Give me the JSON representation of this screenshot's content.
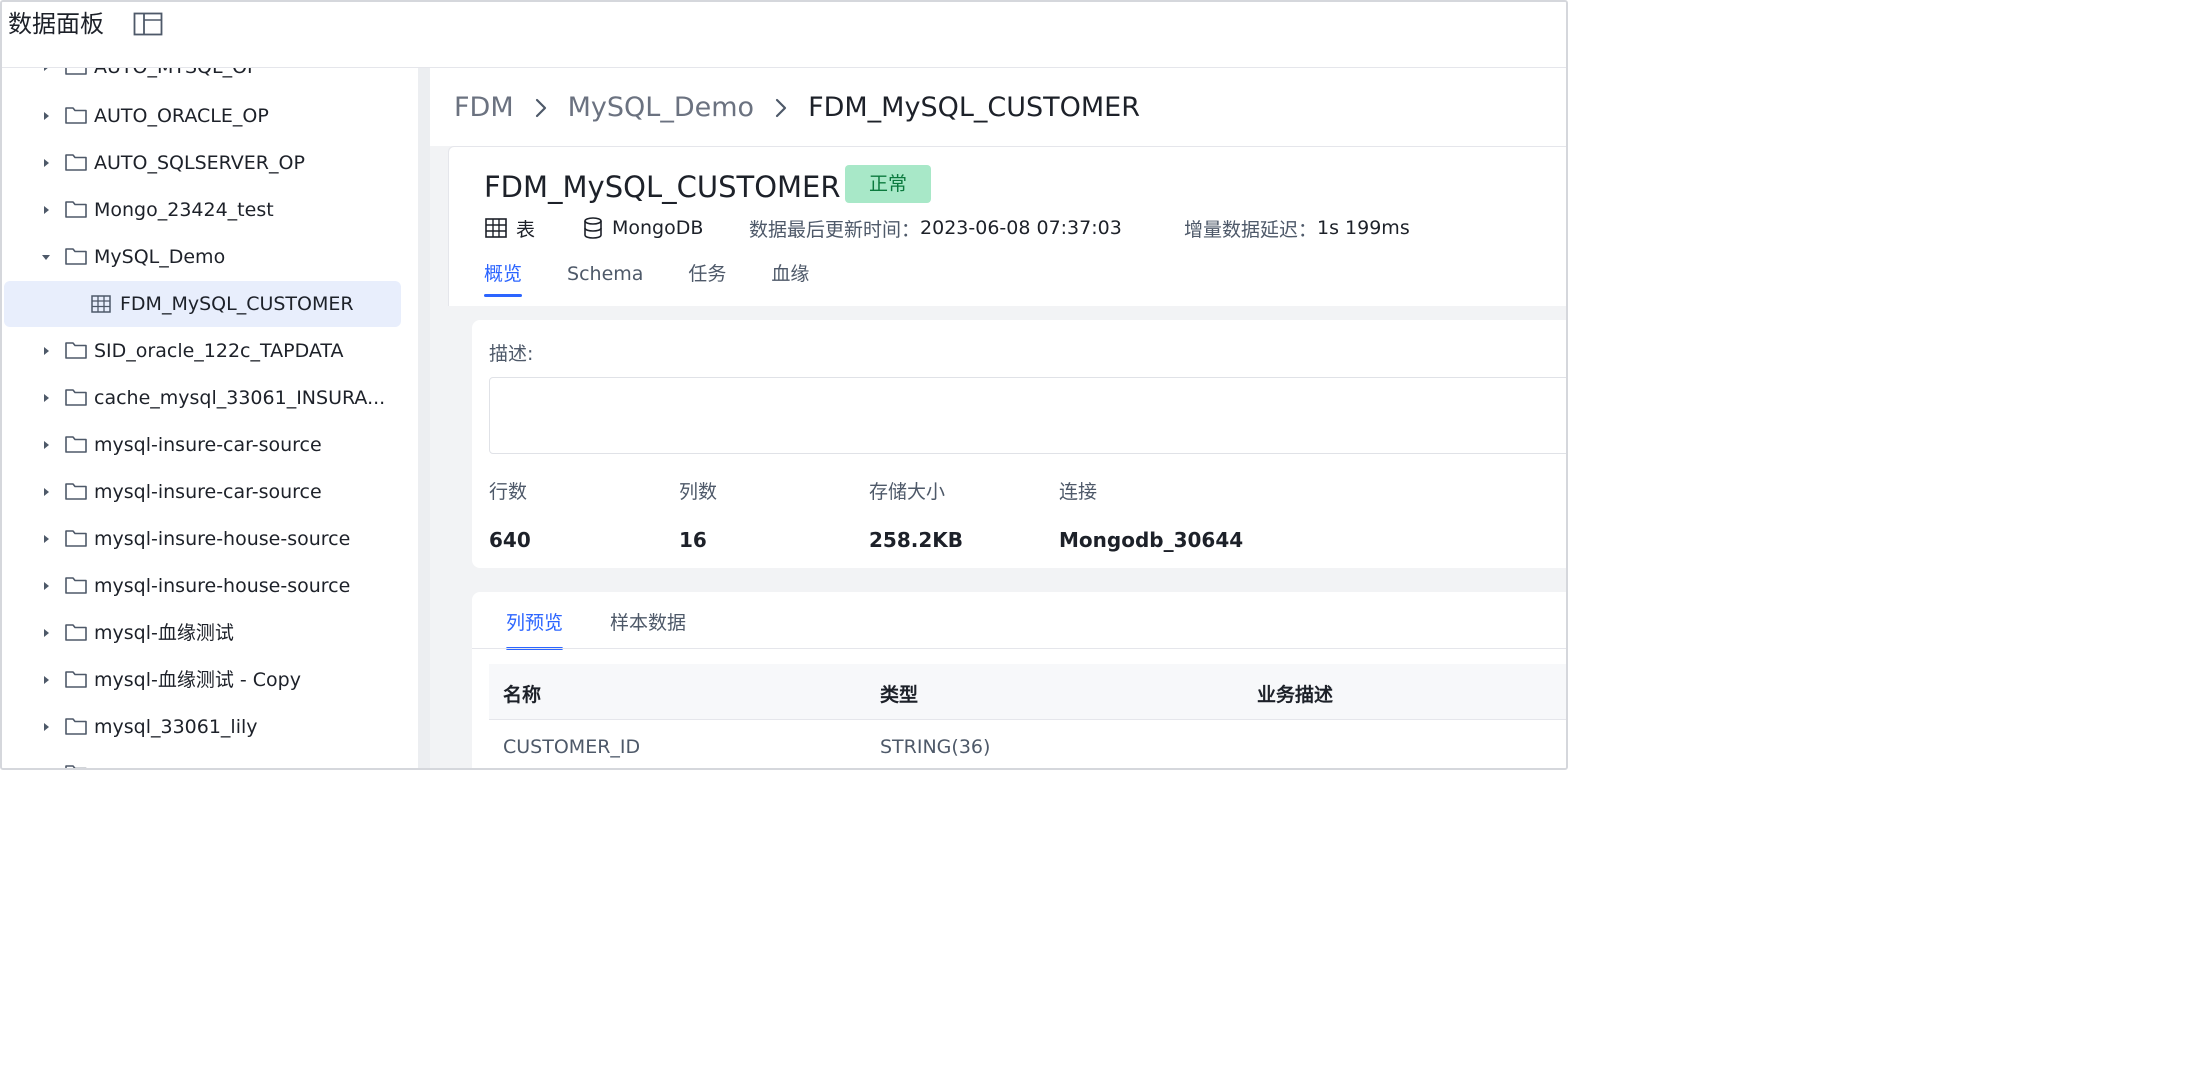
{
  "header": {
    "title": "数据面板",
    "layout_icon": "panel-layout-icon"
  },
  "sidebar": {
    "items": [
      {
        "label": "AUTO_MYSQL_OP",
        "expanded": false
      },
      {
        "label": "AUTO_ORACLE_OP",
        "expanded": false
      },
      {
        "label": "AUTO_SQLSERVER_OP",
        "expanded": false
      },
      {
        "label": "Mongo_23424_test",
        "expanded": false
      },
      {
        "label": "MySQL_Demo",
        "expanded": true
      },
      {
        "label": "FDM_MySQL_CUSTOMER",
        "child": true,
        "selected": true
      },
      {
        "label": "SID_oracle_122c_TAPDATA",
        "expanded": false
      },
      {
        "label": "cache_mysql_33061_INSURA...",
        "expanded": false
      },
      {
        "label": "mysql-insure-car-source",
        "expanded": false
      },
      {
        "label": "mysql-insure-car-source",
        "expanded": false
      },
      {
        "label": "mysql-insure-house-source",
        "expanded": false
      },
      {
        "label": "mysql-insure-house-source",
        "expanded": false
      },
      {
        "label": "mysql-血缘测试",
        "expanded": false
      },
      {
        "label": "mysql-血缘测试 - Copy",
        "expanded": false
      },
      {
        "label": "mysql_33061_lily",
        "expanded": false
      }
    ]
  },
  "breadcrumb": [
    "FDM",
    "MySQL_Demo",
    "FDM_MySQL_CUSTOMER"
  ],
  "detail": {
    "name": "FDM_MySQL_CUSTOMER",
    "status": "正常",
    "type_label": "表",
    "db_label": "MongoDB",
    "updated_label": "数据最后更新时间：",
    "updated_value": "2023-06-08 07:37:03",
    "delay_label": "增量数据延迟：",
    "delay_value": "1s 199ms",
    "tabs": [
      "概览",
      "Schema",
      "任务",
      "血缘"
    ]
  },
  "overview": {
    "desc_label": "描述:",
    "stats": [
      {
        "label": "行数",
        "value": "640"
      },
      {
        "label": "列数",
        "value": "16"
      },
      {
        "label": "存储大小",
        "value": "258.2KB"
      },
      {
        "label": "连接",
        "value": "Mongodb_30644"
      }
    ]
  },
  "columns": {
    "tabs": [
      "列预览",
      "样本数据"
    ],
    "headers": [
      "名称",
      "类型",
      "业务描述"
    ],
    "rows": [
      [
        "CUSTOMER_ID",
        "STRING(36)",
        ""
      ]
    ]
  },
  "colors": {
    "accent": "#2c65ff",
    "status_bg": "#a8e8c8",
    "status_text": "#0b7a3e",
    "selected_bg": "#e8eefc"
  }
}
